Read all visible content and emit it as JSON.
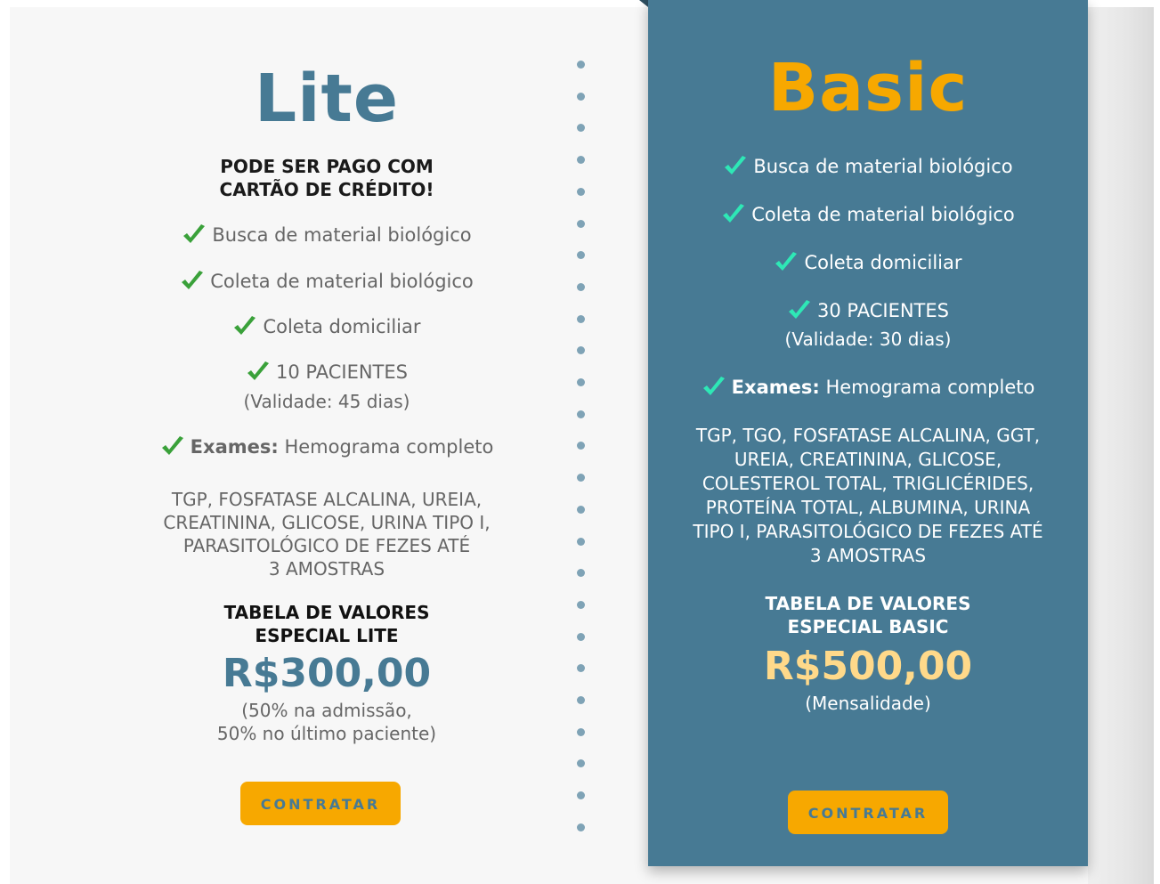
{
  "plans": {
    "lite": {
      "title": "Lite",
      "payment_note_line1": "PODE SER PAGO COM",
      "payment_note_line2": "CARTÃO DE CRÉDITO!",
      "features": [
        "Busca de material biológico",
        "Coleta de material biológico",
        "Coleta domiciliar",
        "10 PACIENTES"
      ],
      "patients_validity": "(Validade: 45 dias)",
      "exams_label": "Exames:",
      "exams_first": "Hemograma completo",
      "exams_list_lines": [
        "TGP, FOSFATASE ALCALINA, UREIA,",
        "CREATININA, GLICOSE, URINA TIPO I,",
        "PARASITOLÓGICO DE FEZES ATÉ",
        "3 AMOSTRAS"
      ],
      "table_title_line1": "TABELA DE VALORES",
      "table_title_line2": "ESPECIAL LITE",
      "price": "R$300,00",
      "price_note_line1": "(50% na admissão,",
      "price_note_line2": "50% no último paciente)",
      "cta_label": "CONTRATAR"
    },
    "basic": {
      "title": "Basic",
      "features": [
        "Busca de material biológico",
        "Coleta de material biológico",
        "Coleta domiciliar",
        "30 PACIENTES"
      ],
      "patients_validity": "(Validade: 30 dias)",
      "exams_label": "Exames:",
      "exams_first": "Hemograma completo",
      "exams_list_lines": [
        "TGP, TGO, FOSFATASE ALCALINA, GGT,",
        "UREIA, CREATININA, GLICOSE,",
        "COLESTEROL TOTAL, TRIGLICÉRIDES,",
        "PROTEÍNA TOTAL, ALBUMINA, URINA",
        "TIPO I, PARASITOLÓGICO DE FEZES ATÉ",
        "3 AMOSTRAS"
      ],
      "table_title_line1": "TABELA DE VALORES",
      "table_title_line2": "ESPECIAL BASIC",
      "price": "R$500,00",
      "price_note": "(Mensalidade)",
      "cta_label": "CONTRATAR"
    }
  },
  "colors": {
    "brand_blue": "#477a94",
    "accent_orange": "#f7a800",
    "price_basic": "#ffd98a",
    "check_lite": "#3aa13a",
    "check_basic": "#2ee8b6",
    "divider_dots": "#7fa3b6"
  },
  "icons": {
    "check": "check-icon"
  }
}
